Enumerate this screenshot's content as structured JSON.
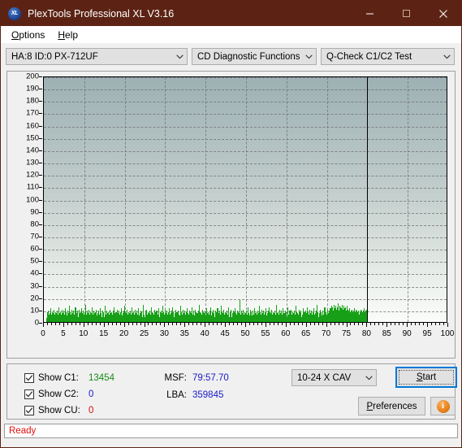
{
  "window": {
    "title": "PlexTools Professional XL V3.16",
    "icon": "xl-logo-icon",
    "icon_text": "XL",
    "titlebar_color": "#5c2314",
    "minimize": "minimize-icon",
    "maximize": "maximize-icon",
    "close": "close-icon"
  },
  "menu": {
    "items": [
      {
        "label": "Options",
        "accel": "O"
      },
      {
        "label": "Help",
        "accel": "H"
      }
    ]
  },
  "toolbar": {
    "drive_select": "HA:8 ID:0  PX-712UF",
    "function_select": "CD Diagnostic Functions",
    "test_select": "Q-Check C1/C2 Test"
  },
  "chart_data": {
    "type": "bar",
    "title": "",
    "xlabel": "",
    "ylabel": "",
    "xlim": [
      0,
      100
    ],
    "ylim": [
      0,
      200
    ],
    "xticks": [
      0,
      5,
      10,
      15,
      20,
      25,
      30,
      35,
      40,
      45,
      50,
      55,
      60,
      65,
      70,
      75,
      80,
      85,
      90,
      95,
      100
    ],
    "yticks": [
      0,
      10,
      20,
      30,
      40,
      50,
      60,
      70,
      80,
      90,
      100,
      110,
      120,
      130,
      140,
      150,
      160,
      170,
      180,
      190,
      200
    ],
    "grid": true,
    "legend": "none",
    "series_color": "#17a017",
    "data_end_marker_x": 80,
    "series": [
      {
        "name": "C1",
        "color": "#17a017",
        "x_start": 0.6,
        "x_end": 80.0,
        "values": [
          3,
          8,
          5,
          4,
          9,
          6,
          4,
          7,
          5,
          11,
          6,
          4,
          8,
          5,
          7,
          4,
          10,
          6,
          5,
          8,
          4,
          7,
          5,
          9,
          6,
          4,
          12,
          7,
          5,
          8,
          4,
          6,
          10,
          5,
          7,
          4,
          9,
          6,
          5,
          11,
          7,
          4,
          8,
          5,
          6,
          9,
          4,
          7,
          13,
          5,
          8,
          4,
          6,
          10,
          5,
          7,
          4,
          9,
          6,
          5,
          8,
          12,
          4,
          7,
          5,
          9,
          6,
          4,
          10,
          5,
          7,
          4,
          8,
          6,
          11,
          5,
          7,
          4,
          9,
          6,
          5,
          8,
          4,
          14,
          6,
          5,
          9,
          4,
          7,
          10,
          5,
          6,
          4,
          8,
          5,
          7,
          12,
          4,
          6,
          9,
          5,
          7,
          4,
          8,
          6,
          10,
          5,
          4,
          7,
          5,
          9,
          6,
          4,
          8,
          11,
          5,
          7,
          4,
          6,
          9,
          5,
          8,
          4,
          7,
          13,
          5,
          6,
          4,
          9,
          7,
          5,
          8,
          4,
          6,
          10,
          5,
          7,
          4,
          8,
          6,
          5,
          9,
          12,
          4,
          7,
          5,
          6,
          8,
          4,
          10,
          5,
          7,
          4,
          9,
          6,
          5,
          8,
          4,
          11,
          6,
          5,
          7,
          4,
          9,
          6,
          13,
          5,
          8,
          4,
          7,
          5,
          10,
          6,
          4,
          8,
          5,
          7,
          9,
          4,
          6,
          5,
          12,
          7,
          4,
          8,
          5,
          6,
          10,
          4,
          7,
          5,
          9,
          6,
          4,
          8,
          11,
          5,
          7,
          4,
          6,
          9,
          5,
          8,
          4,
          7,
          14,
          5,
          6,
          4,
          9,
          7,
          5,
          10,
          4,
          6,
          8,
          5,
          7,
          4,
          9,
          6,
          5,
          12,
          8,
          4,
          7,
          5,
          6,
          10,
          4,
          8,
          5,
          7,
          9,
          4,
          6,
          5,
          11,
          7,
          4,
          8,
          5,
          6,
          9,
          4,
          7,
          13,
          5,
          8,
          4,
          6,
          10,
          5,
          7,
          4,
          9,
          6,
          5,
          8,
          4,
          11,
          6,
          5,
          7,
          4,
          9,
          12,
          6,
          5,
          8,
          4,
          7,
          5,
          10,
          6,
          4,
          8,
          5,
          7,
          9,
          4,
          6,
          5,
          13,
          7,
          4,
          8,
          5,
          6,
          10,
          4,
          7,
          5,
          9,
          6,
          4,
          8,
          11,
          5,
          7,
          4,
          6,
          9,
          5,
          8,
          4,
          7,
          12,
          5,
          6,
          4,
          9,
          7,
          5,
          10,
          4,
          6,
          8,
          5,
          7,
          4,
          9,
          6,
          5,
          14,
          8,
          4,
          7,
          5,
          6,
          10,
          4,
          8,
          5,
          7,
          9,
          4,
          6,
          5,
          11,
          7,
          4,
          8,
          5,
          6,
          9,
          4,
          7,
          12,
          5,
          8,
          4,
          6,
          10,
          5,
          7,
          4,
          9,
          6,
          5,
          8,
          4,
          11,
          6,
          5,
          7,
          4,
          9,
          6,
          13,
          5,
          8,
          4,
          7,
          5,
          10,
          6,
          4,
          8,
          5,
          7,
          9,
          4,
          6,
          5,
          12,
          7,
          4,
          8,
          5,
          6,
          10,
          4,
          7,
          5,
          9,
          6,
          4,
          8,
          11,
          5,
          7,
          4,
          6,
          9,
          5,
          8,
          4,
          7,
          18,
          5,
          6,
          4,
          9,
          7,
          5,
          10,
          4,
          6,
          8,
          5,
          7,
          4,
          9,
          6,
          5,
          12,
          8,
          4,
          7,
          5,
          6,
          10,
          4,
          8,
          5,
          7,
          9,
          4,
          6,
          5,
          11,
          7,
          4,
          8,
          5,
          6,
          9,
          4,
          7,
          13,
          5,
          8,
          4,
          6,
          10,
          5,
          7,
          4,
          9,
          6,
          5,
          8,
          4,
          11,
          6,
          5,
          7,
          4,
          9,
          6,
          12,
          5,
          8,
          4,
          7,
          5,
          10,
          6,
          4,
          8,
          5,
          7,
          9,
          4,
          6,
          5,
          14,
          7,
          4,
          8,
          5,
          6,
          10,
          4,
          7,
          5,
          9,
          6,
          4,
          8,
          11,
          5,
          7,
          4,
          6,
          9,
          5,
          8,
          4,
          7,
          12,
          5,
          6,
          4,
          9,
          7,
          5,
          10,
          4,
          6,
          8,
          5,
          7,
          4,
          9,
          6,
          5,
          13,
          8,
          4,
          7,
          5,
          6,
          10,
          4,
          8,
          5,
          7,
          9,
          4,
          6,
          5,
          11,
          7,
          4,
          8,
          5,
          6,
          9,
          4,
          7,
          12,
          5,
          8,
          4,
          6,
          10,
          5,
          7,
          4,
          9,
          6,
          5,
          8,
          4,
          11,
          6,
          5,
          7,
          4,
          9,
          6,
          14,
          5,
          8,
          4,
          7,
          5,
          10,
          6,
          4,
          8,
          5,
          7,
          9,
          4,
          6,
          5,
          12,
          7,
          4,
          8,
          5,
          6,
          10,
          4,
          7,
          5,
          9,
          8,
          11,
          9,
          13,
          10,
          8,
          12,
          9,
          14,
          10,
          8,
          11,
          13,
          9,
          10,
          12,
          8,
          15,
          11,
          9,
          13,
          10,
          8,
          12,
          9,
          11,
          14,
          10,
          8,
          13,
          9,
          11,
          10,
          12,
          8,
          9,
          11,
          13,
          10,
          8,
          9,
          7,
          11,
          8,
          6,
          9,
          7,
          10,
          8,
          6,
          9,
          7,
          11,
          8,
          6,
          10,
          7,
          9,
          8,
          6,
          7,
          9,
          6,
          8,
          7,
          10,
          6,
          9,
          7,
          8,
          6,
          9,
          7,
          11,
          8,
          6,
          9,
          7,
          10,
          8
        ]
      }
    ]
  },
  "controls": {
    "checkboxes": [
      {
        "name": "show-c1",
        "label": "Show C1:",
        "value": "13454",
        "checked": true,
        "color": "#1a8a1a"
      },
      {
        "name": "show-c2",
        "label": "Show C2:",
        "value": "0",
        "checked": true,
        "color": "#1a1ac8"
      },
      {
        "name": "show-cu",
        "label": "Show CU:",
        "value": "0",
        "checked": true,
        "color": "#d01010"
      }
    ],
    "msf_label": "MSF:",
    "msf_value": "79:57.70",
    "lba_label": "LBA:",
    "lba_value": "359845",
    "speed_select": "10-24 X CAV",
    "start_button": "Start",
    "start_accel": "S",
    "preferences_button": "Preferences",
    "preferences_accel": "P",
    "info_button": "info-icon",
    "info_glyph": "i"
  },
  "statusbar": {
    "text": "Ready",
    "color": "#e01010"
  }
}
